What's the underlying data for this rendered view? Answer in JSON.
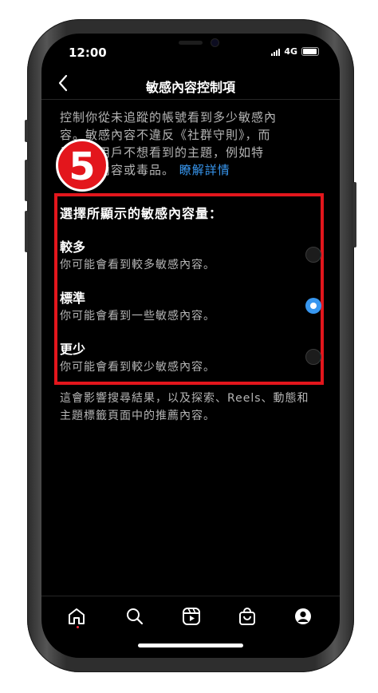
{
  "status_bar": {
    "time": "12:00",
    "network": "4G"
  },
  "header": {
    "title": "敏感內容控制項",
    "back_icon": "chevron-left-icon"
  },
  "description": {
    "line1": "控制你從未追蹤的帳號看到多少敏感內",
    "line2": "容。敏感內容不違反《社群守則》，而",
    "line3": "是部分用戶不想看到的主題，例如特",
    "line4_prefix": "定藥物內容或毒品。",
    "learn_more": "瞭解詳情"
  },
  "step_badge": "5",
  "section": {
    "title": "選擇所顯示的敏感內容量：",
    "options": [
      {
        "label": "較多",
        "desc": "你可能會看到較多敏感內容。",
        "selected": false
      },
      {
        "label": "標準",
        "desc": "你可能會看到一些敏感內容。",
        "selected": true
      },
      {
        "label": "更少",
        "desc": "你可能會看到較少敏感內容。",
        "selected": false
      }
    ]
  },
  "footer_note": {
    "line1": "這會影響搜尋結果，以及探索、Reels、動態和",
    "line2": "主題標籤頁面中的推薦內容。"
  },
  "tabbar": {
    "icons": [
      "home-icon",
      "search-icon",
      "reels-icon",
      "shop-icon",
      "profile-icon"
    ]
  },
  "colors": {
    "accent": "#3897f0",
    "highlight": "#e3161c",
    "background": "#000000"
  }
}
